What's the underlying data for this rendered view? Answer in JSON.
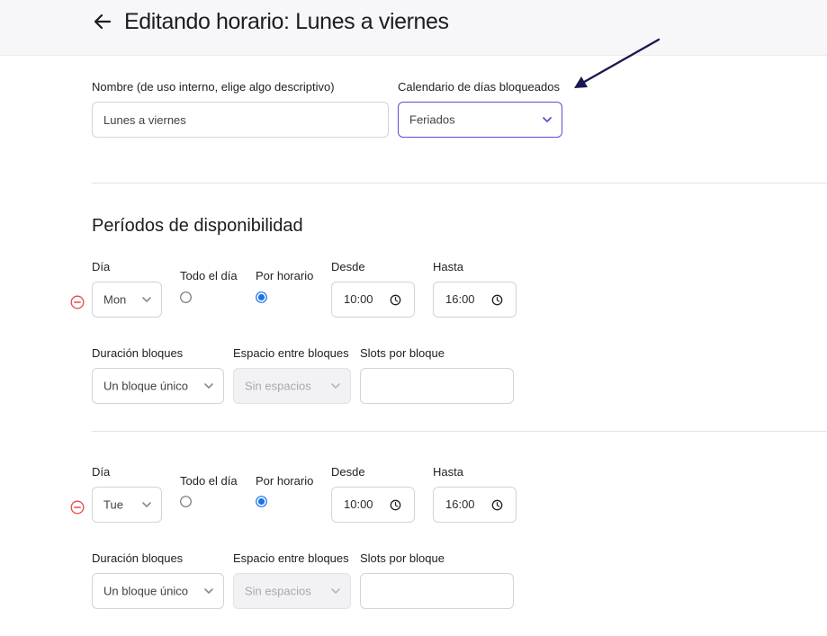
{
  "header": {
    "title": "Editando horario: Lunes a viernes"
  },
  "general": {
    "name_label": "Nombre (de uso interno, elige algo descriptivo)",
    "name_value": "Lunes a viernes",
    "calendar_label": "Calendario de días bloqueados",
    "calendar_value": "Feriados"
  },
  "availability": {
    "section_title": "Períodos de disponibilidad",
    "periods": [
      {
        "day_label": "Día",
        "day_value": "Mon",
        "all_day_label": "Todo el día",
        "by_schedule_label": "Por horario",
        "from_label": "Desde",
        "from_value": "10:00",
        "to_label": "Hasta",
        "to_value": "16:00",
        "duration_label": "Duración bloques",
        "duration_value": "Un bloque único",
        "spacing_label": "Espacio entre bloques",
        "spacing_value": "Sin espacios",
        "slots_label": "Slots por bloque",
        "slots_value": ""
      },
      {
        "day_label": "Día",
        "day_value": "Tue",
        "all_day_label": "Todo el día",
        "by_schedule_label": "Por horario",
        "from_label": "Desde",
        "from_value": "10:00",
        "to_label": "Hasta",
        "to_value": "16:00",
        "duration_label": "Duración bloques",
        "duration_value": "Un bloque único",
        "spacing_label": "Espacio entre bloques",
        "spacing_value": "Sin espacios",
        "slots_label": "Slots por bloque",
        "slots_value": ""
      }
    ]
  },
  "colors": {
    "accent": "#5b4fcf",
    "radio_selected": "#1a73e8",
    "remove": "#e5484d",
    "annotation_arrow": "#1b1850"
  },
  "icons": {
    "back": "arrow-left-icon",
    "chevron": "chevron-down-icon",
    "clock": "clock-icon",
    "remove": "minus-circle-icon",
    "annotation": "annotation-arrow-icon"
  }
}
